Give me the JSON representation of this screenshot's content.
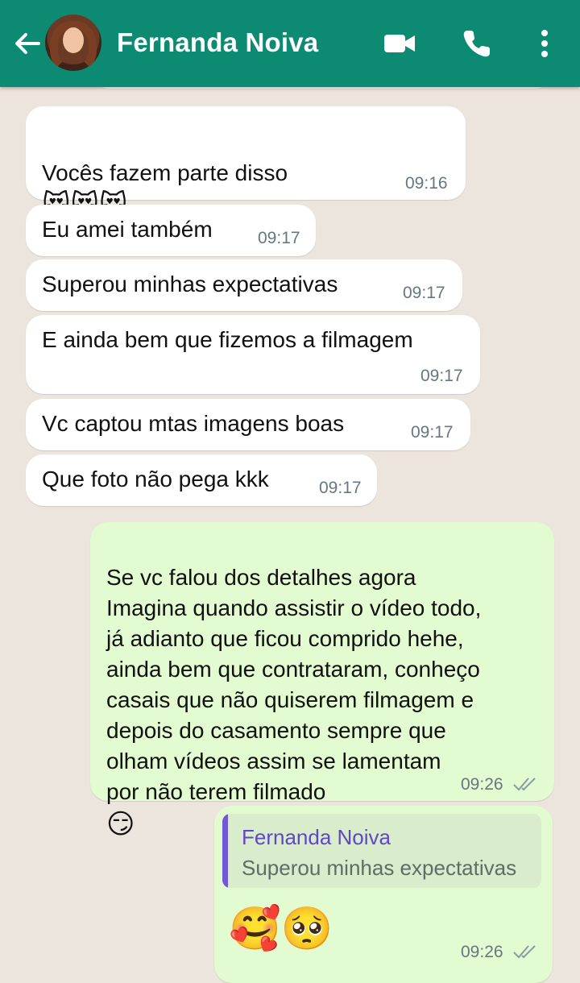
{
  "header": {
    "contact_name": "Fernanda Noiva",
    "back_icon": "back-arrow-icon",
    "video_icon": "video-call-icon",
    "call_icon": "phone-icon",
    "menu_icon": "more-vertical-icon",
    "color": "#0c8a72"
  },
  "messages": [
    {
      "direction": "in",
      "text": "Vocês fazem parte disso",
      "emoji": "😻😻😻",
      "time": "09:16"
    },
    {
      "direction": "in",
      "text": "Eu amei também",
      "time": "09:17"
    },
    {
      "direction": "in",
      "text": "Superou minhas expectativas",
      "time": "09:17"
    },
    {
      "direction": "in",
      "text": "E ainda bem que fizemos a filmagem",
      "time": "09:17"
    },
    {
      "direction": "in",
      "text": "Vc captou mtas imagens boas",
      "time": "09:17"
    },
    {
      "direction": "in",
      "text": "Que foto não pega kkk",
      "time": "09:17"
    },
    {
      "direction": "out",
      "text": "Se vc falou dos detalhes agora\nImagina quando assistir o vídeo todo,\njá adianto que ficou comprido hehe,\nainda bem que contrataram, conheço\ncasais que não quiserem filmagem e\ndepois do casamento sempre que\nolham vídeos assim se lamentam\npor não terem filmado",
      "emoji": "😏",
      "time": "09:26",
      "status": "read"
    },
    {
      "direction": "out",
      "reply_to": {
        "name": "Fernanda Noiva",
        "text": "Superou minhas expectativas"
      },
      "emoji": "🥰🥺",
      "time": "09:26",
      "status": "read"
    }
  ]
}
